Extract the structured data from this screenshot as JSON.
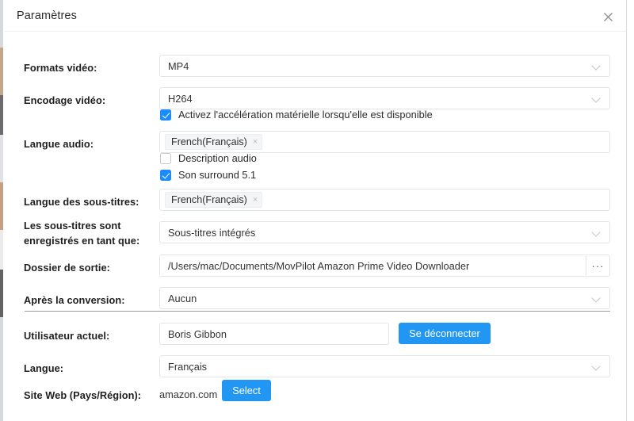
{
  "dialog": {
    "title": "Paramètres",
    "close_icon": "close-icon"
  },
  "accent_color": "#2196f3",
  "fields": {
    "video_formats": {
      "label": "Formats vidéo:",
      "value": "MP4",
      "icon": "chevron-down-icon"
    },
    "video_encoding": {
      "label": "Encodage vidéo:",
      "value": "H264",
      "icon": "chevron-down-icon"
    },
    "hardware_acceleration": {
      "label": "Activez l'accélération matérielle lorsqu'elle est disponible",
      "checked": true
    },
    "audio_language": {
      "label": "Langue audio:",
      "tag": "French(Français)",
      "remove_icon": "×"
    },
    "audio_description": {
      "label": "Description audio",
      "checked": false
    },
    "surround_sound": {
      "label": "Son surround 5.1",
      "checked": true
    },
    "subtitle_language": {
      "label": "Langue des sous-titres:",
      "tag": "French(Français)",
      "remove_icon": "×"
    },
    "subtitle_saved_as": {
      "label_line1": "Les sous-titres sont",
      "label_line2": "enregistrés en tant que:",
      "value": "Sous-titres intégrés",
      "icon": "chevron-down-icon"
    },
    "output_folder": {
      "label": "Dossier de sortie:",
      "value": "/Users/mac/Documents/MovPilot Amazon Prime Video Downloader",
      "browse_label": "···"
    },
    "after_conversion": {
      "label": "Après la conversion:",
      "value": "Aucun",
      "icon": "chevron-down-icon"
    },
    "current_user": {
      "label": "Utilisateur actuel:",
      "value": "Boris Gibbon",
      "logout_label": "Se déconnecter"
    },
    "language": {
      "label": "Langue:",
      "value": "Français",
      "icon": "chevron-down-icon"
    },
    "website_region": {
      "label": "Site Web (Pays/Région):",
      "value": "amazon.com",
      "select_label": "Select"
    }
  }
}
